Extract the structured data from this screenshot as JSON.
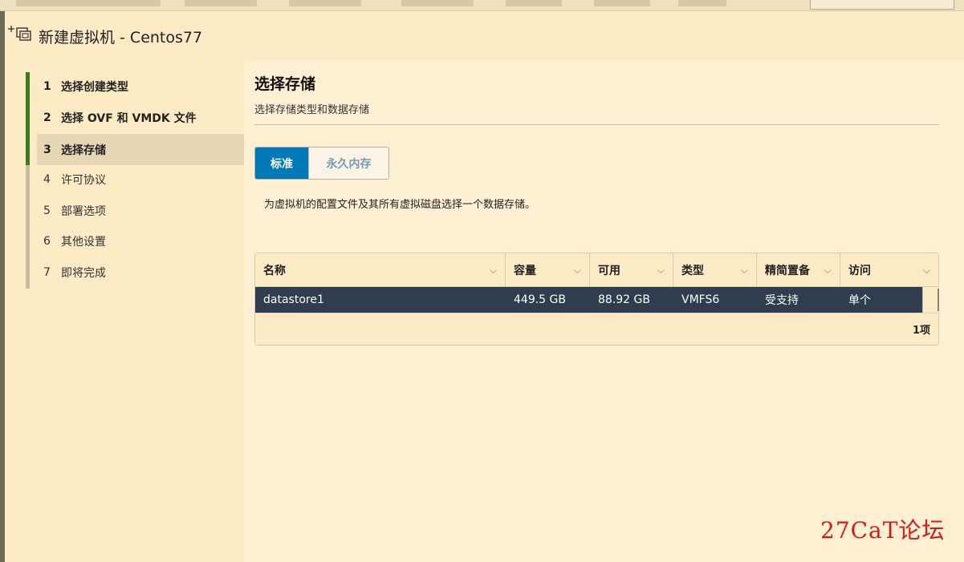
{
  "dialog": {
    "title": "新建虚拟机 - Centos77",
    "icon": "new-vm-icon"
  },
  "wizard_steps": [
    {
      "num": "1",
      "label": "选择创建类型"
    },
    {
      "num": "2",
      "label": "选择 OVF 和 VMDK 文件"
    },
    {
      "num": "3",
      "label": "选择存储"
    },
    {
      "num": "4",
      "label": "许可协议"
    },
    {
      "num": "5",
      "label": "部署选项"
    },
    {
      "num": "6",
      "label": "其他设置"
    },
    {
      "num": "7",
      "label": "即将完成"
    }
  ],
  "page": {
    "title": "选择存储",
    "subtitle": "选择存储类型和数据存储",
    "storage_type_tabs": [
      "标准",
      "永久内存"
    ],
    "instruction": "为虚拟机的配置文件及其所有虚拟磁盘选择一个数据存储。"
  },
  "datastore_grid": {
    "columns": [
      "名称",
      "容量",
      "可用",
      "类型",
      "精简置备",
      "访问"
    ],
    "rows": [
      [
        "datastore1",
        "449.5 GB",
        "88.92 GB",
        "VMFS6",
        "受支持",
        "单个"
      ]
    ],
    "footer": "1项"
  },
  "watermark": "27CaT论坛",
  "colors": {
    "accent": "#0079b8",
    "selected_row": "#2f3d4f",
    "completed_step": "#3a7a1a",
    "background": "#fdebc6",
    "watermark": "#d51a1a"
  }
}
